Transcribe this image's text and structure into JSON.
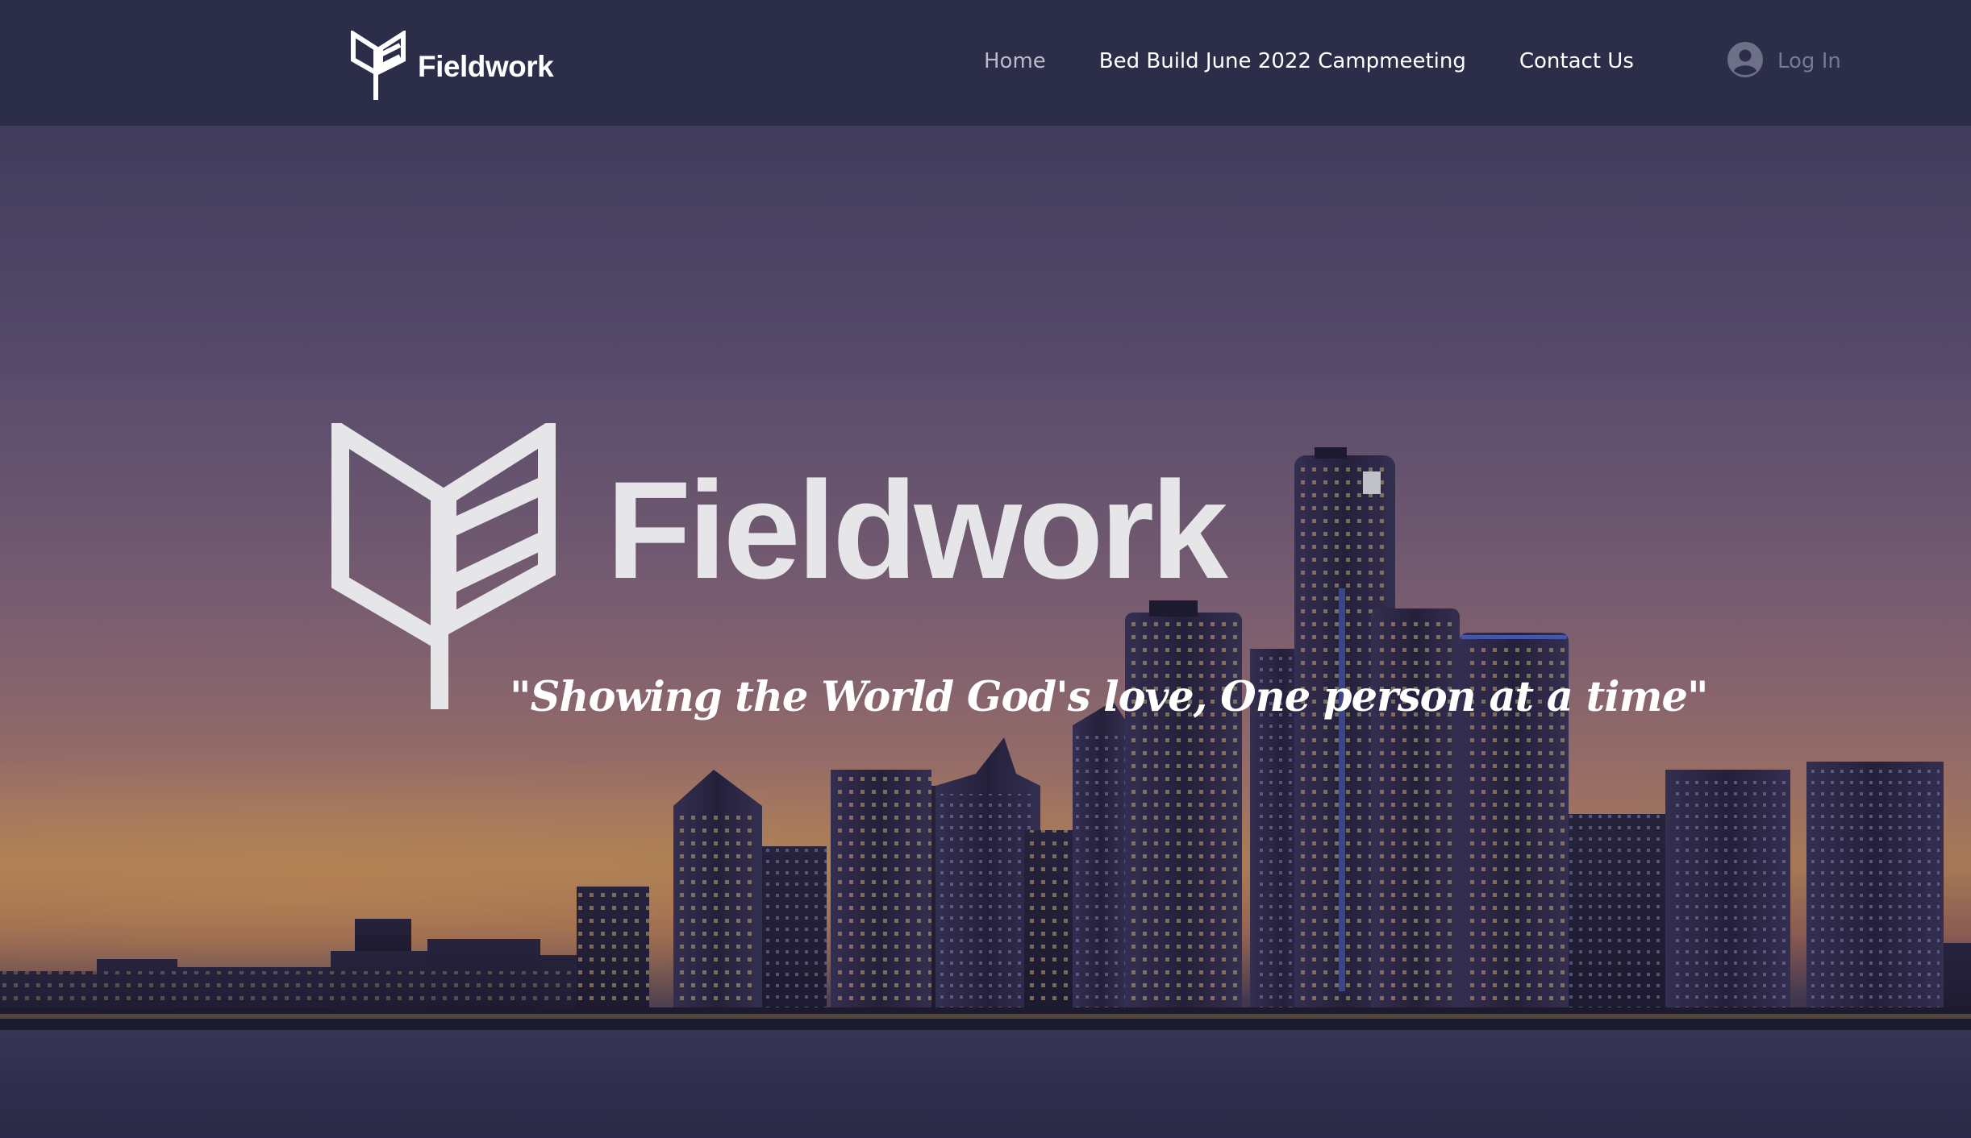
{
  "header": {
    "logo_icon": "fieldwork-book-icon",
    "logo_text": "Fieldwork",
    "background": "#2c2d49"
  },
  "nav": {
    "items": [
      {
        "label": "Home",
        "active": true
      },
      {
        "label": "Bed Build June 2022 Campmeeting",
        "active": false
      },
      {
        "label": "Contact Us",
        "active": false
      }
    ]
  },
  "login": {
    "icon": "user-avatar-icon",
    "label": "Log In"
  },
  "hero": {
    "background": "city-skyline-at-dusk",
    "logo_icon": "fieldwork-book-icon",
    "wordmark": "Fieldwork",
    "tagline": "\"Showing the World God's love, One person at a time\""
  },
  "colors": {
    "header_bg": "#2c2d49",
    "nav_active": "#b9bbc9",
    "nav_text": "#ffffff",
    "login_text": "#767993",
    "wordmark": "#e6e6e8"
  }
}
